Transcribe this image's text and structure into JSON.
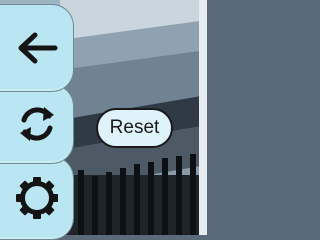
{
  "toolbar": {
    "buttons": [
      {
        "id": "back",
        "icon": "arrow-left-icon"
      },
      {
        "id": "reset",
        "icon": "refresh-icon"
      },
      {
        "id": "settings",
        "icon": "gear-icon"
      }
    ]
  },
  "reset_button": {
    "label": "Reset"
  },
  "colors": {
    "toolbar_bg": "#b9e6f2",
    "pill_bg": "#dff3fa",
    "icon": "#141414"
  }
}
